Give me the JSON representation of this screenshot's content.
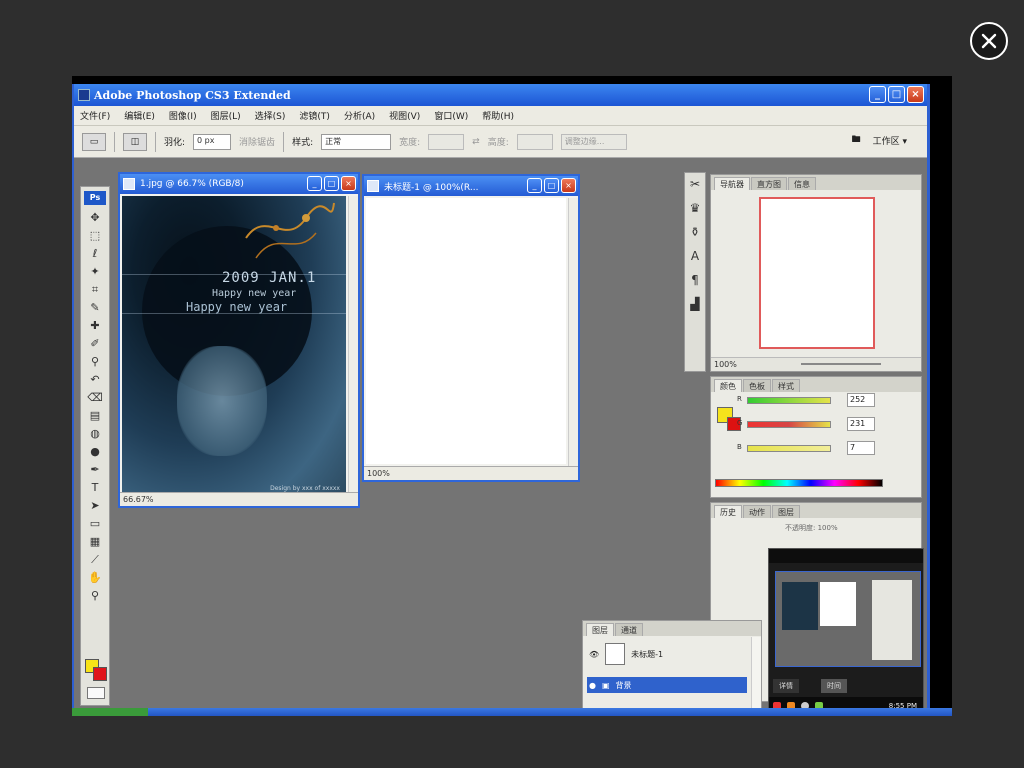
{
  "lightbox": {
    "close_icon": "close-icon"
  },
  "app": {
    "title": "Adobe Photoshop CS3 Extended",
    "menus": [
      "文件(F)",
      "编辑(E)",
      "图像(I)",
      "图层(L)",
      "选择(S)",
      "滤镜(T)",
      "分析(A)",
      "视图(V)",
      "窗口(W)",
      "帮助(H)"
    ],
    "options": {
      "feather_label": "羽化:",
      "feather_value": "0 px",
      "antialias_label": "消除锯齿",
      "style_label": "样式:",
      "style_value": "正常",
      "width_label": "宽度:",
      "height_label": "高度:",
      "refine_edge": "调整边缘...",
      "workspace_label": "工作区 ▾"
    }
  },
  "documents": [
    {
      "title": "1.jpg @ 66.7% (RGB/8)",
      "zoom": "66.67%",
      "photo_text": {
        "date": "2009 JAN.1",
        "line2": "Happy new year",
        "line3": "Happy new year",
        "credit": "Design by xxx of xxxxx"
      }
    },
    {
      "title": "未标题-1 @ 100%(R...",
      "zoom": "100%"
    }
  ],
  "panels": {
    "navigator": {
      "tabs": [
        "导航器",
        "直方图",
        "信息"
      ],
      "zoom": "100%"
    },
    "color": {
      "tabs": [
        "颜色",
        "色板",
        "样式"
      ],
      "channels": [
        {
          "label": "R",
          "value": "252",
          "color": "#e6e34a"
        },
        {
          "label": "G",
          "value": "231",
          "color": "#d64545"
        },
        {
          "label": "B",
          "value": "7",
          "color": "#e6e34a"
        }
      ]
    },
    "history": {
      "tabs": [
        "历史",
        "动作",
        "图层"
      ],
      "opacity_label": "不透明度:",
      "opacity_value": "100%"
    },
    "layers": {
      "tabs": [
        "图层",
        "通道"
      ],
      "rows": [
        {
          "name": "未标题-1"
        },
        {
          "name": "背景"
        }
      ]
    }
  },
  "mini_window": {
    "tabs": [
      "详情",
      "时间"
    ],
    "clock": "8:55 PM"
  }
}
